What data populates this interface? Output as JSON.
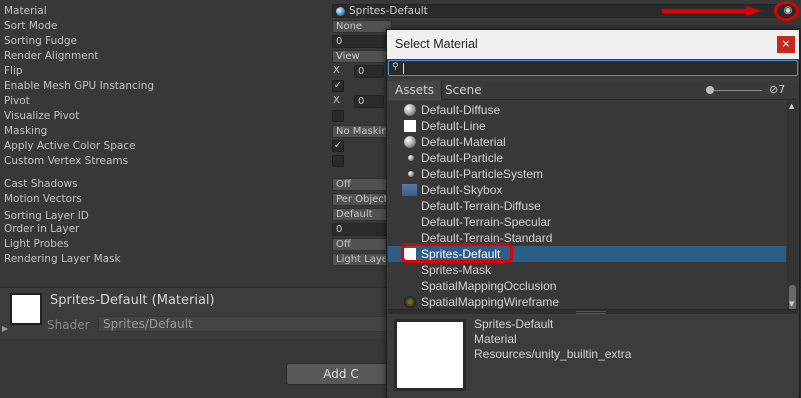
{
  "inspector": {
    "rows": [
      {
        "label": "Material"
      },
      {
        "label": "Sort Mode",
        "value": "None"
      },
      {
        "label": "Sorting Fudge",
        "value": "0"
      },
      {
        "label": "Render Alignment",
        "value": "View"
      },
      {
        "label": "Flip",
        "x_label": "X",
        "x_value": "0"
      },
      {
        "label": "Enable Mesh GPU Instancing",
        "checked": true
      },
      {
        "label": "Pivot",
        "x_label": "X",
        "x_value": "0"
      },
      {
        "label": "Visualize Pivot",
        "checked": false
      },
      {
        "label": "Masking",
        "value": "No Maskin"
      },
      {
        "label": "Apply Active Color Space",
        "checked": true
      },
      {
        "label": "Custom Vertex Streams",
        "checked": false
      },
      {
        "label": "Cast Shadows",
        "value": "Off"
      },
      {
        "label": "Motion Vectors",
        "value": "Per Object"
      },
      {
        "label": "Sorting Layer ID",
        "value": "Default"
      },
      {
        "label": "Order in Layer",
        "value": "0"
      },
      {
        "label": "Light Probes",
        "value": "Off"
      },
      {
        "label": "Rendering Layer Mask",
        "value": "Light Laye"
      }
    ],
    "material_value": "Sprites-Default",
    "picker_icon": "target-icon",
    "material_header": {
      "title": "Sprites-Default (Material)",
      "shader_label": "Shader",
      "shader_value": "Sprites/Default"
    },
    "add_button_label": "Add C"
  },
  "popup": {
    "title": "Select Material",
    "close_glyph": "×",
    "search_value": "",
    "tabs": [
      "Assets",
      "Scene"
    ],
    "visibility_count": "7",
    "items": [
      {
        "name": "Default-Diffuse",
        "icon": "sphere"
      },
      {
        "name": "Default-Line",
        "icon": "white"
      },
      {
        "name": "Default-Material",
        "icon": "sphere"
      },
      {
        "name": "Default-Particle",
        "icon": "dot"
      },
      {
        "name": "Default-ParticleSystem",
        "icon": "dot"
      },
      {
        "name": "Default-Skybox",
        "icon": "sky"
      },
      {
        "name": "Default-Terrain-Diffuse",
        "icon": "none"
      },
      {
        "name": "Default-Terrain-Specular",
        "icon": "none"
      },
      {
        "name": "Default-Terrain-Standard",
        "icon": "none"
      },
      {
        "name": "Sprites-Default",
        "icon": "white",
        "selected": true
      },
      {
        "name": "Sprites-Mask",
        "icon": "none"
      },
      {
        "name": "SpatialMappingOcclusion",
        "icon": "none"
      },
      {
        "name": "SpatialMappingWireframe",
        "icon": "dark"
      }
    ],
    "preview": {
      "name": "Sprites-Default",
      "type": "Material",
      "path": "Resources/unity_builtin_extra"
    }
  },
  "colors": {
    "background": "#383838",
    "selection": "#2c5d87",
    "annotation": "#e00000",
    "close_button": "#c42b1c"
  }
}
